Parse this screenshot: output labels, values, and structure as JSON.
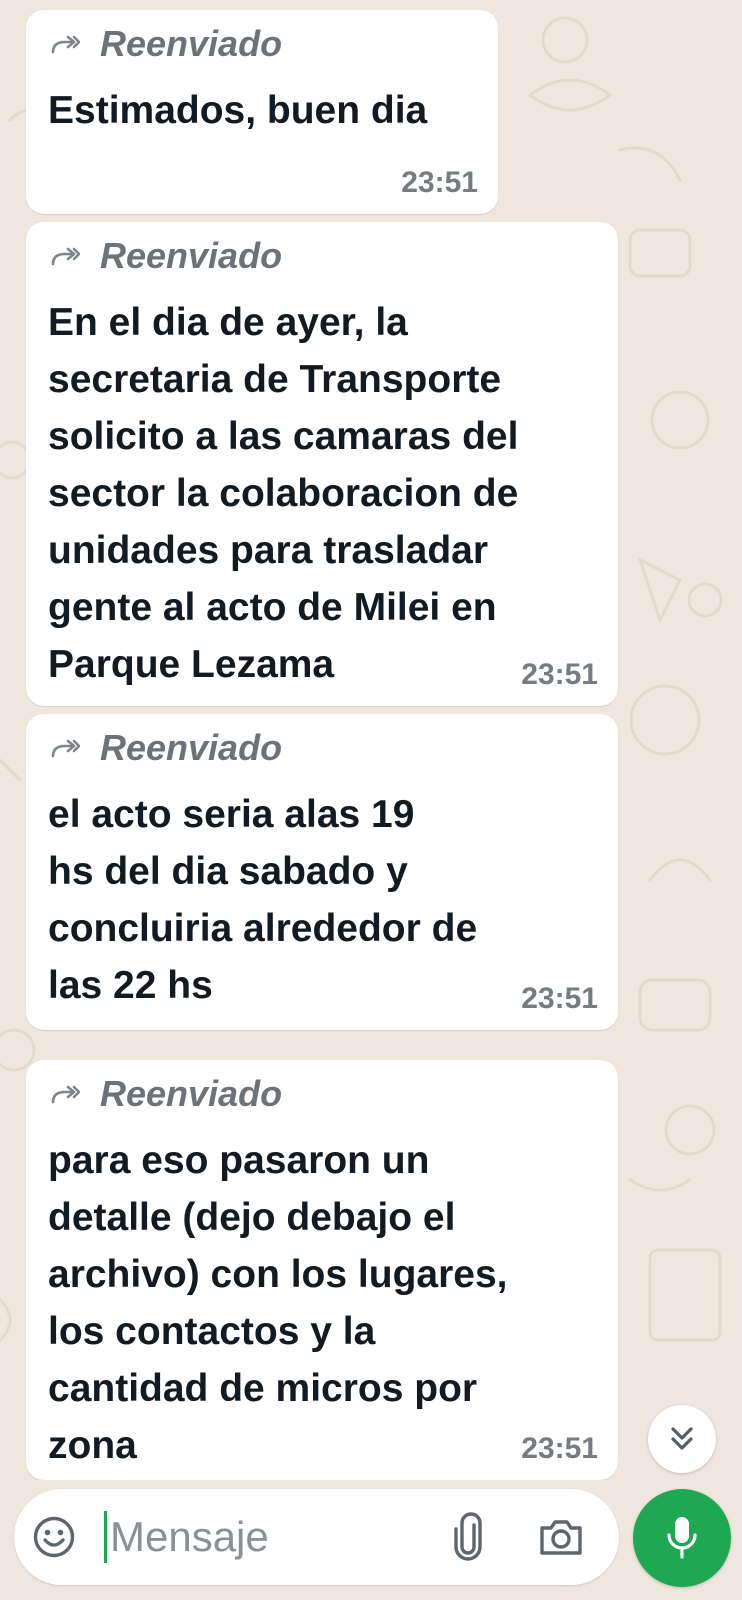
{
  "messages": [
    {
      "forwarded_label": "Reenviado",
      "text": "Estimados, buen dia",
      "time": "23:51"
    },
    {
      "forwarded_label": "Reenviado",
      "text": "En el dia de ayer, la\nsecretaria de Transporte\nsolicito a las camaras del\nsector la colaboracion de\nunidades para trasladar\ngente al acto de Milei en\nParque Lezama",
      "time": "23:51"
    },
    {
      "forwarded_label": "Reenviado",
      "text": "el acto seria alas 19\nhs del dia sabado y\nconcluiria alrededor de\nlas 22 hs",
      "time": "23:51"
    },
    {
      "forwarded_label": "Reenviado",
      "text": "para eso pasaron un\ndetalle (dejo debajo el\narchivo) con los lugares,\nlos contactos y la\ncantidad de micros por\nzona",
      "time": "23:51"
    }
  ],
  "composer": {
    "placeholder": "Mensaje",
    "icons": [
      "emoji-icon",
      "attach-icon",
      "camera-icon",
      "mic-icon"
    ]
  },
  "scroll_down_icon": "double-chevron-down-icon",
  "colors": {
    "chat_background": "#efe7de",
    "bubble": "#ffffff",
    "accent_green": "#1da851",
    "forwarded_text": "#6b7378",
    "message_text": "#111b21",
    "timestamp": "#767d81"
  }
}
